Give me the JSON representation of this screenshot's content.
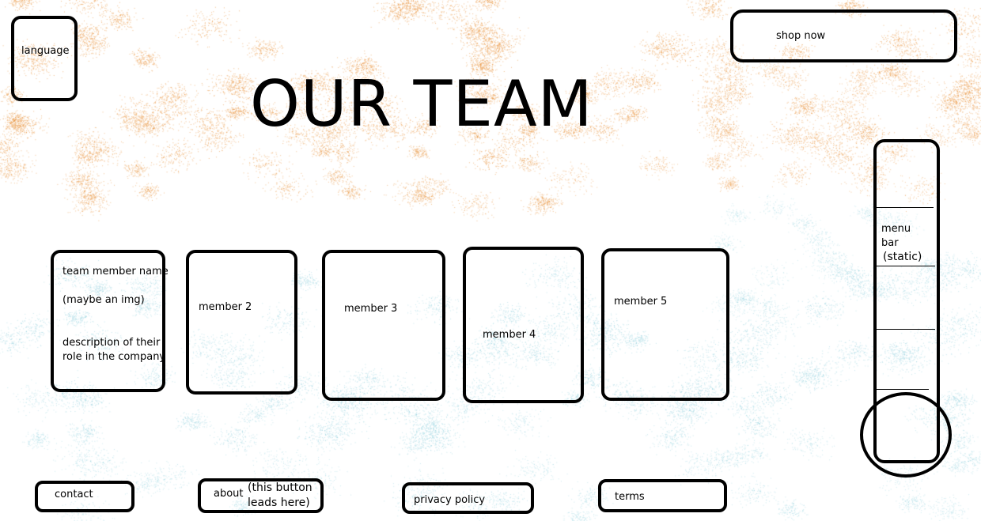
{
  "colors": {
    "orange_speckle": "#e8892a",
    "blue_speckle": "#7ec8d6",
    "outline": "#000000"
  },
  "header": {
    "language_label": "language",
    "shop_label": "shop now",
    "title": "OUR TEAM"
  },
  "team": {
    "card1": {
      "name": "team member name",
      "img": "(maybe an img)",
      "desc_line1": "description of their",
      "desc_line2": "role in the company"
    },
    "card2": "member 2",
    "card3": "member 3",
    "card4": "member 4",
    "card5": "member 5"
  },
  "menu": {
    "line1": "menu",
    "line2": "bar",
    "line3": "(static)"
  },
  "footer": {
    "contact": "contact",
    "about": "about",
    "about_note_line1": "(this button",
    "about_note_line2": "leads here)",
    "privacy": "privacy policy",
    "terms": "terms"
  }
}
